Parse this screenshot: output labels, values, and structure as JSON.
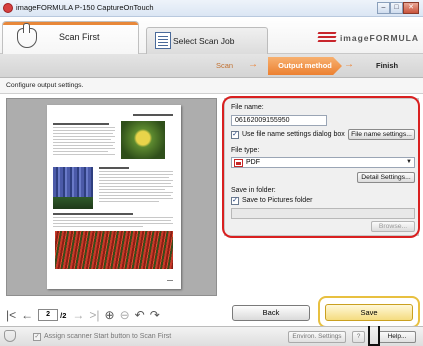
{
  "window": {
    "title": "imageFORMULA P-150 CaptureOnTouch",
    "min_label": "–",
    "max_label": "□",
    "close_label": "✕"
  },
  "header": {
    "tab_scan_first": "Scan First",
    "tab_scan_job": "Select Scan Job",
    "brand": "imageFORMULA"
  },
  "steps": {
    "scan": "Scan",
    "output": "Output method",
    "finish": "Finish",
    "arrow": "→"
  },
  "config_text": "Configure output settings.",
  "form": {
    "file_name_label": "File name:",
    "file_name_value": "06162009155950",
    "use_dialog_label": "Use file name settings dialog box",
    "use_dialog_checked": true,
    "file_name_settings_button": "File name settings...",
    "file_type_label": "File type:",
    "file_type_value": "PDF",
    "detail_settings_button": "Detail Settings...",
    "save_in_folder_label": "Save in folder:",
    "save_to_pictures_label": "Save to Pictures folder",
    "save_to_pictures_checked": true,
    "folder_path": "",
    "browse_button": "Browse..."
  },
  "navigation": {
    "first": "|<",
    "prev": "←",
    "next": "→",
    "last": ">|",
    "zoom_in": "⊕",
    "zoom_out": "⊖",
    "rotate_left": "↶",
    "rotate_right": "↷",
    "current_page": "2",
    "total_pages": "/2"
  },
  "actions": {
    "back": "Back",
    "save": "Save"
  },
  "statusbar": {
    "assign_label": "Assign scanner Start button to Scan First",
    "environ_settings": "Environ. Settings",
    "question": "?",
    "help": "Help..."
  },
  "check_mark": "✓"
}
